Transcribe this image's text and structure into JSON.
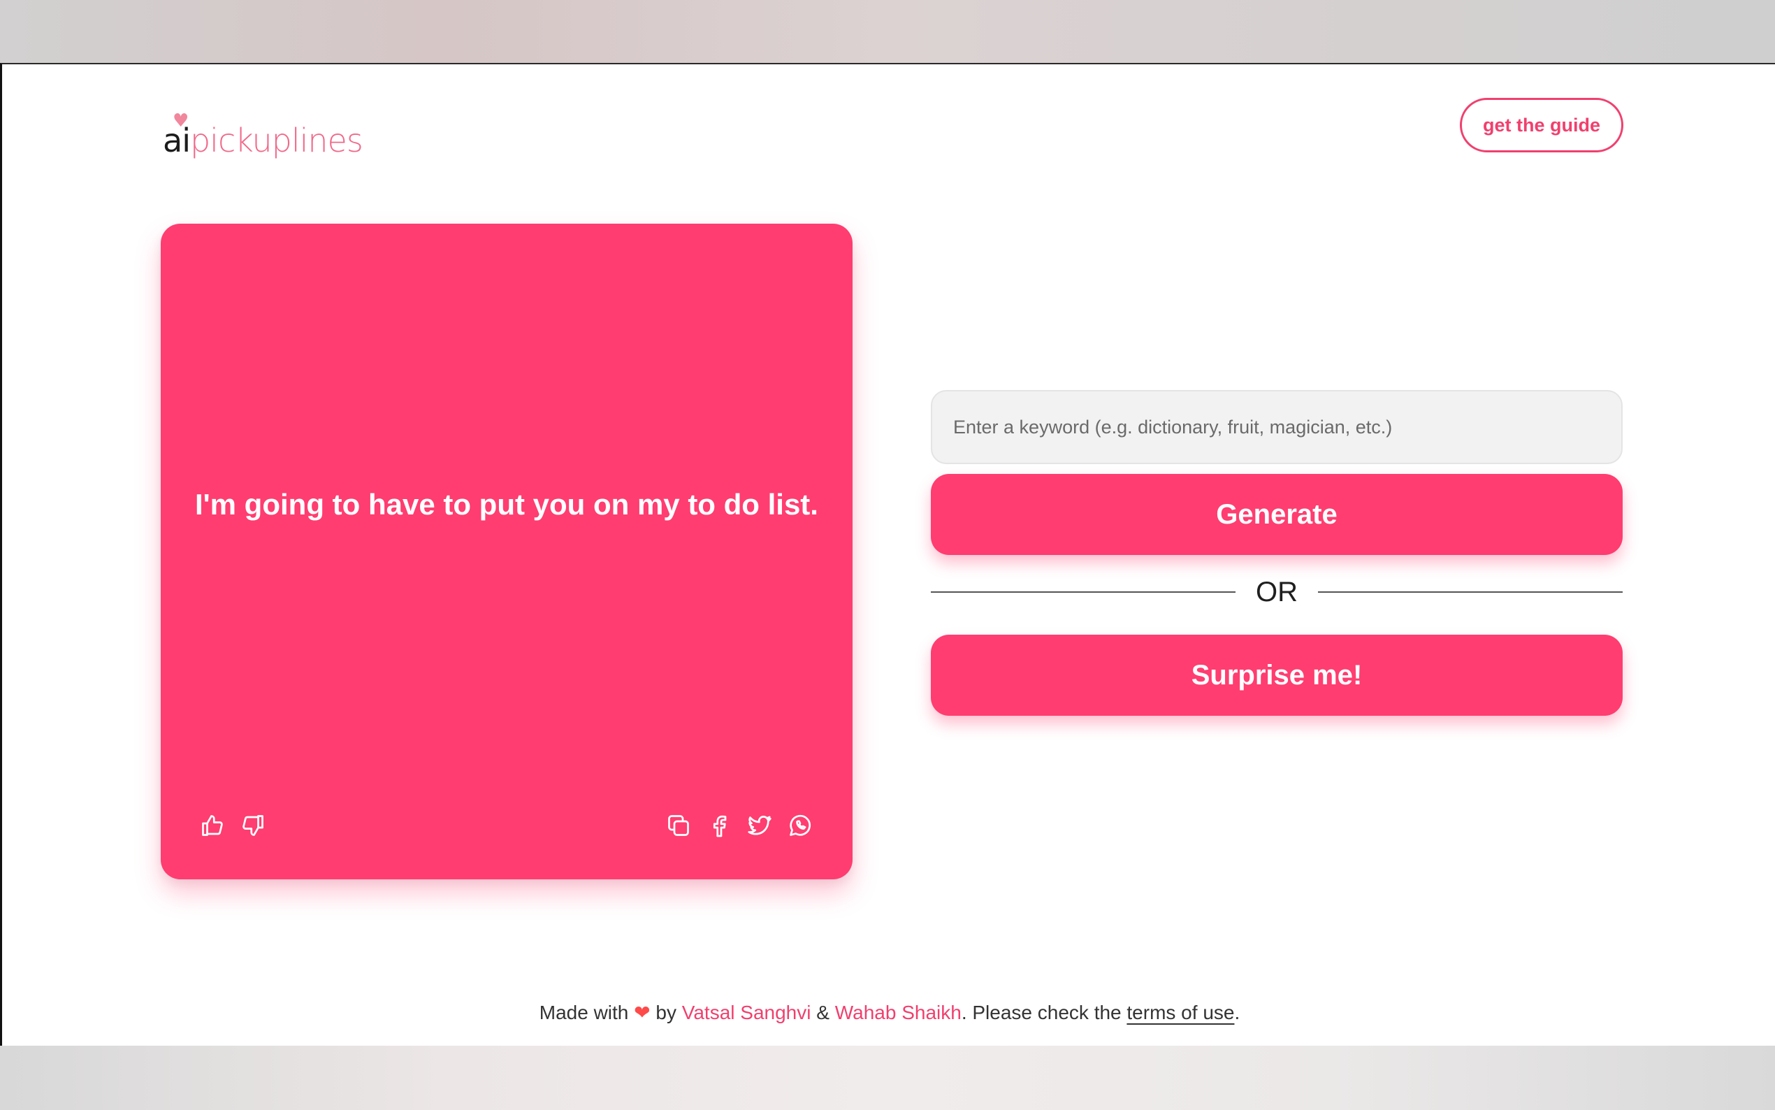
{
  "header": {
    "logo_ai": "ai",
    "logo_rest": "pickuplines",
    "logo_heart": "♥",
    "guide_label": "get the guide"
  },
  "card": {
    "line": "I'm going to have to put you on my to do list.",
    "icons_left": [
      "thumbs-up-icon",
      "thumbs-down-icon"
    ],
    "icons_right": [
      "copy-icon",
      "facebook-icon",
      "twitter-icon",
      "whatsapp-icon"
    ]
  },
  "form": {
    "keyword_placeholder": "Enter a keyword (e.g. dictionary, fruit, magician, etc.)",
    "keyword_value": "",
    "generate_label": "Generate",
    "or_label": "OR",
    "surprise_label": "Surprise me!"
  },
  "footer": {
    "made_with": "Made with",
    "heart": "❤",
    "by": "by",
    "author1": "Vatsal Sanghvi",
    "amp": "&",
    "author2": "Wahab Shaikh",
    "please_check": ". Please check the",
    "terms": "terms of use",
    "period": "."
  },
  "colors": {
    "accent": "#ff3d70",
    "accent_text": "#f0406e",
    "logo_pink": "#f06a8a"
  }
}
